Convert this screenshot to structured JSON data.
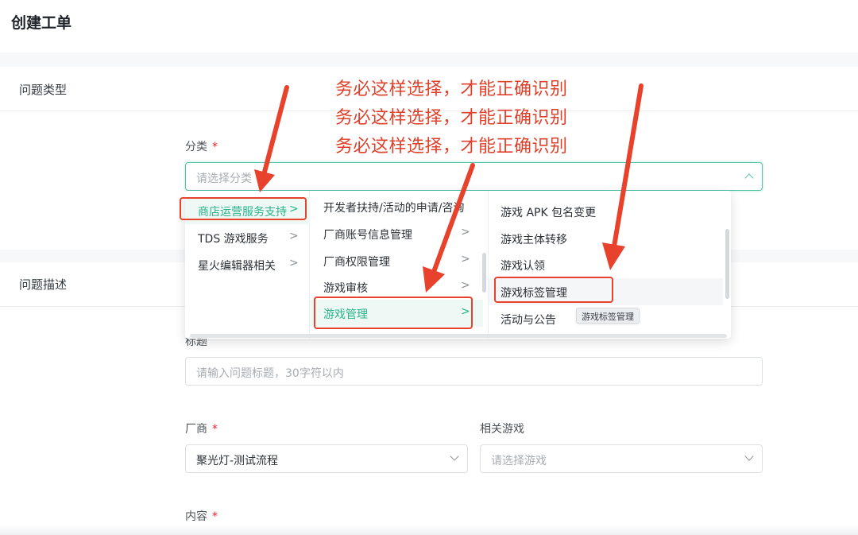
{
  "page": {
    "title": "创建工单"
  },
  "sections": {
    "type": {
      "title": "问题类型"
    },
    "desc": {
      "title": "问题描述"
    }
  },
  "category": {
    "label": "分类",
    "required_mark": "*",
    "placeholder": "请选择分类"
  },
  "cascader": {
    "level1": [
      {
        "label": "商店运营服务支持",
        "arrow": ">"
      },
      {
        "label": "TDS 游戏服务",
        "arrow": ">"
      },
      {
        "label": "星火编辑器相关",
        "arrow": ">"
      }
    ],
    "level2": [
      {
        "label": "开发者扶持/活动的申请/咨询"
      },
      {
        "label": "厂商账号信息管理",
        "arrow": ">"
      },
      {
        "label": "厂商权限管理",
        "arrow": ">"
      },
      {
        "label": "游戏审核",
        "arrow": ">"
      },
      {
        "label": "游戏管理",
        "arrow": ">"
      }
    ],
    "level3": [
      {
        "label": "游戏 APK 包名变更"
      },
      {
        "label": "游戏主体转移"
      },
      {
        "label": "游戏认领"
      },
      {
        "label": "游戏标签管理"
      },
      {
        "label": "活动与公告"
      }
    ],
    "tooltip": "游戏标签管理"
  },
  "annotations": [
    "务必这样选择，才能正确识别",
    "务必这样选择，才能正确识别",
    "务必这样选择，才能正确识别"
  ],
  "title_field": {
    "label": "标题",
    "placeholder": "请输入问题标题，30字符以内"
  },
  "vendor": {
    "label": "厂商",
    "required_mark": "*",
    "value": "聚光灯-测试流程"
  },
  "related_game": {
    "label": "相关游戏",
    "placeholder": "请选择游戏"
  },
  "content": {
    "label": "内容",
    "required_mark": "*"
  },
  "colors": {
    "accent": "#29b38a",
    "annotation": "#e0402a",
    "required": "#f5222d"
  }
}
